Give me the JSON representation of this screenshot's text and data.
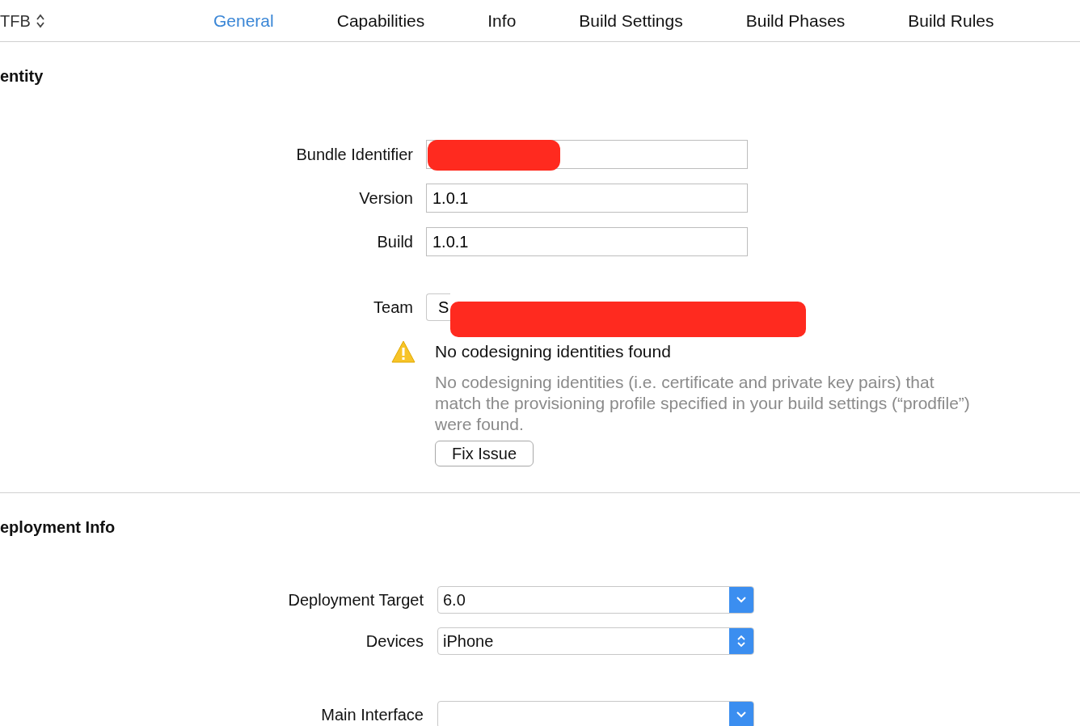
{
  "header": {
    "target": "TFB"
  },
  "tabs": [
    {
      "label": "General",
      "selected": true
    },
    {
      "label": "Capabilities",
      "selected": false
    },
    {
      "label": "Info",
      "selected": false
    },
    {
      "label": "Build Settings",
      "selected": false
    },
    {
      "label": "Build Phases",
      "selected": false
    },
    {
      "label": "Build Rules",
      "selected": false
    }
  ],
  "identity": {
    "title": "entity",
    "fields": [
      {
        "kind": "text",
        "label": "Bundle Identifier",
        "redacted": true
      },
      {
        "kind": "text",
        "label": "Version",
        "value": "1.0.1",
        "redacted": false
      },
      {
        "kind": "text",
        "label": "Build",
        "value": "1.0.1",
        "redacted": false
      },
      {
        "kind": "popup",
        "label": "Team",
        "value": "S",
        "redacted": true
      }
    ]
  },
  "warning": {
    "title": "No codesigning identities found",
    "message": "No codesigning identities (i.e. certificate and private key pairs) that match the provisioning profile specified in your build settings (“prodfile”) were found.",
    "button": "Fix Issue"
  },
  "deployment": {
    "title": "eployment Info",
    "fields": [
      {
        "kind": "popup-arrow",
        "label": "Deployment Target",
        "value": "6.0"
      },
      {
        "kind": "popup-updown",
        "label": "Devices",
        "value": "iPhone"
      },
      {
        "kind": "popup-arrow",
        "label": "Main Interface"
      }
    ]
  }
}
